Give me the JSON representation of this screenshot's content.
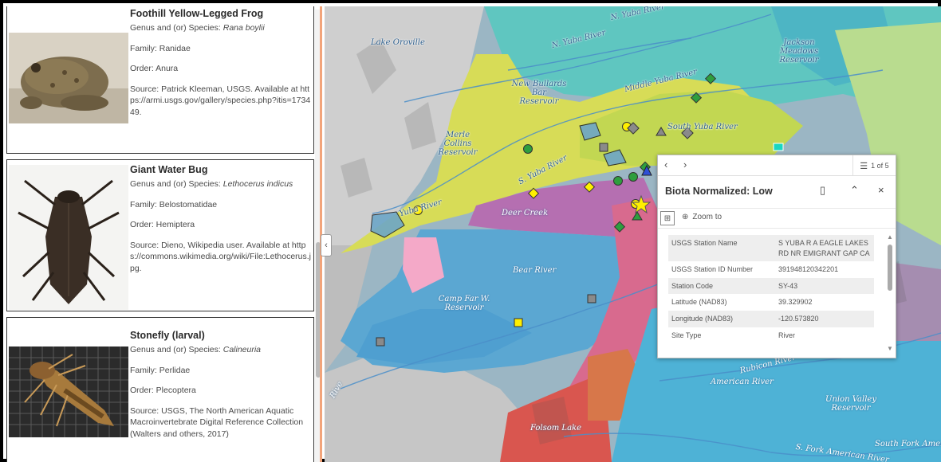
{
  "species": [
    {
      "name": "Foothill Yellow-Legged Frog",
      "genus_label": "Genus and (or) Species: ",
      "genus": "Rana boylii",
      "family": "Family: Ranidae",
      "order": "Order: Anura",
      "source": "Source: Patrick Kleeman, USGS. Available at https://armi.usgs.gov/gallery/species.php?itis=173449."
    },
    {
      "name": "Giant Water Bug",
      "genus_label": "Genus and (or) Species: ",
      "genus": "Lethocerus indicus",
      "family": "Family: Belostomatidae",
      "order": "Order: Hemiptera",
      "source": "Source: Dieno, Wikipedia user. Available at https://commons.wikimedia.org/wiki/File:Lethocerus.jpg."
    },
    {
      "name": "Stonefly (larval)",
      "genus_label": "Genus and (or) Species: ",
      "genus": "Calineuria",
      "family": "Family: Perlidae",
      "order": "Order: Plecoptera",
      "source": "Source: USGS, The North American Aquatic Macroinvertebrate Digital Reference Collection (Walters and others, 2017)"
    }
  ],
  "map": {
    "labels": [
      "Lake Oroville",
      "N. Yuba River",
      "Jackson Meadows Reservoir",
      "New Bullards Bar Reservoir",
      "Middle Yuba River",
      "South Yuba River",
      "Merle Collins Reservoir",
      "S. Yuba River",
      "Yuba River",
      "Deer Creek",
      "Bear River",
      "Camp Far W. Reservoir",
      "American River",
      "Rubicon River",
      "Union Valley Reservoir",
      "Folsom Lake",
      "South Fork American River",
      "S. Fork American River",
      "Rive"
    ]
  },
  "popup": {
    "count": "1 of 5",
    "title": "Biota Normalized: Low",
    "zoom_to": "Zoom to",
    "attributes": [
      {
        "key": "USGS Station Name",
        "value": "S YUBA R A EAGLE LAKES RD NR EMIGRANT GAP CA"
      },
      {
        "key": "USGS Station ID Number",
        "value": "391948120342201"
      },
      {
        "key": "Station Code",
        "value": "SY-43"
      },
      {
        "key": "Latitude (NAD83)",
        "value": "39.329902"
      },
      {
        "key": "Longitude (NAD83)",
        "value": "-120.573820"
      },
      {
        "key": "Site Type",
        "value": "River"
      }
    ]
  },
  "colors": {
    "accent_border": "#f2a47a",
    "marker_yellow": "#ffef00",
    "marker_green": "#2e9e3e",
    "marker_gray": "#8a8a8a"
  }
}
